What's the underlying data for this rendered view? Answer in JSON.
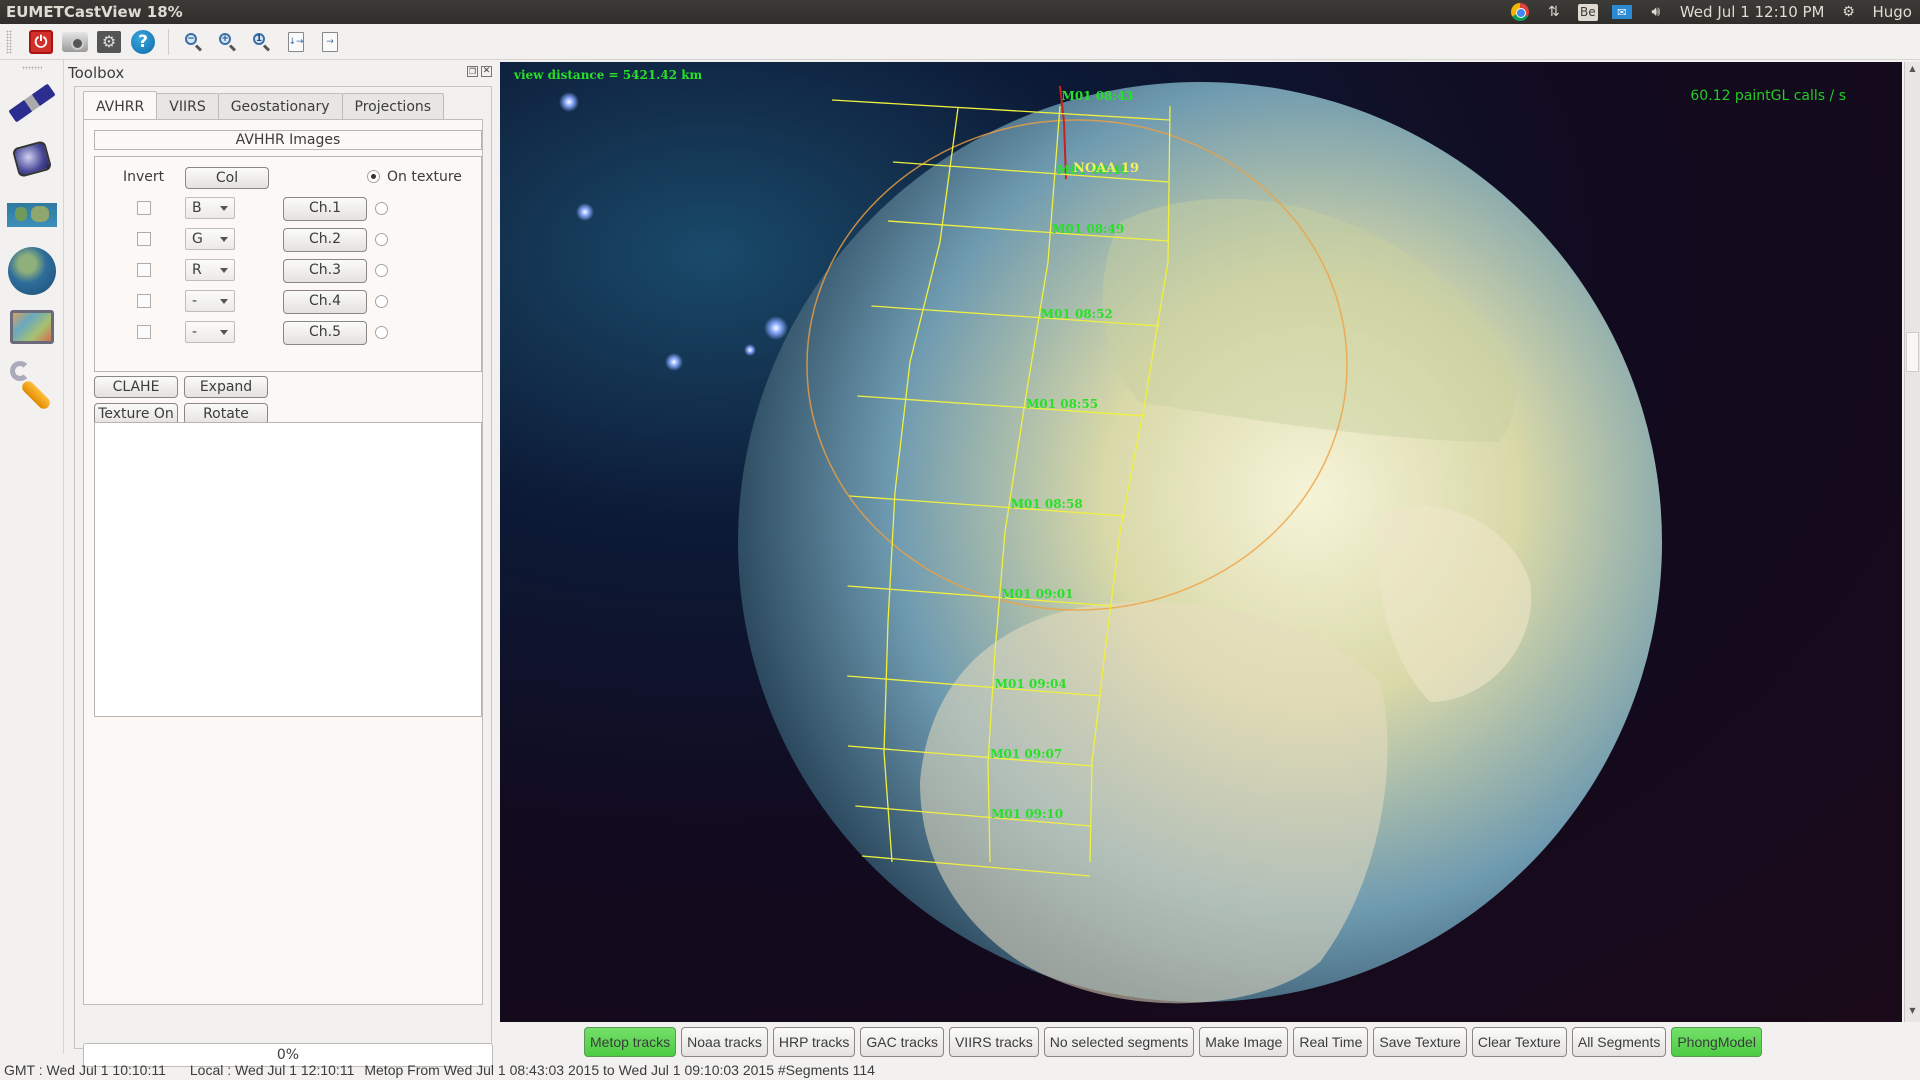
{
  "window": {
    "title": "EUMETCastView 18%"
  },
  "system_tray": {
    "icons": [
      "chrome-icon",
      "network-arrows-icon",
      "be-keyboard-icon",
      "mail-icon",
      "volume-icon"
    ],
    "keyboard_label": "Be",
    "clock": "Wed Jul  1 12:10 PM",
    "user": "Hugo"
  },
  "toolbar": {
    "buttons": [
      "power-icon",
      "camera-icon",
      "settings-icon",
      "help-icon",
      "zoom-out-icon",
      "zoom-in-icon",
      "zoom-reset-icon",
      "page-layout-icon",
      "page-flow-icon"
    ]
  },
  "sidebar": {
    "items": [
      {
        "name": "satellite-avhrr",
        "icon": "satellite-icon"
      },
      {
        "name": "satellite-geo",
        "icon": "satellite-body-icon"
      },
      {
        "name": "flat-map",
        "icon": "flat-map-icon"
      },
      {
        "name": "globe",
        "icon": "globe-icon"
      },
      {
        "name": "image-view",
        "icon": "image-icon"
      },
      {
        "name": "preferences",
        "icon": "wrench-icon"
      }
    ]
  },
  "toolbox": {
    "title": "Toolbox",
    "tabs": [
      {
        "label": "AVHRR",
        "active": true
      },
      {
        "label": "VIIRS",
        "active": false
      },
      {
        "label": "Geostationary",
        "active": false
      },
      {
        "label": "Projections",
        "active": false
      }
    ],
    "group_title": "AVHHR Images",
    "invert_label": "Invert",
    "col_button": "Col",
    "on_texture_label": "On texture",
    "on_texture_checked": true,
    "channels": [
      {
        "invert": false,
        "color": "B",
        "label": "Ch.1",
        "selected": false
      },
      {
        "invert": false,
        "color": "G",
        "label": "Ch.2",
        "selected": false
      },
      {
        "invert": false,
        "color": "R",
        "label": "Ch.3",
        "selected": false
      },
      {
        "invert": false,
        "color": "-",
        "label": "Ch.4",
        "selected": false
      },
      {
        "invert": false,
        "color": "-",
        "label": "Ch.5",
        "selected": false
      }
    ],
    "buttons": {
      "clahe": "CLAHE",
      "expand": "Expand",
      "texture_on": "Texture On",
      "rotate": "Rotate"
    },
    "log_text": "",
    "progress": "0%"
  },
  "view": {
    "distance_text": "view distance =  5421.42 km",
    "fps_text": "60.12 paintGL calls / s",
    "satellite_label": "NOAA 19",
    "segment_labels": [
      "M01 08:43",
      "M01 08:46",
      "M01 08:49",
      "M01 08:52",
      "M01 08:55",
      "M01 08:58",
      "M01 09:01",
      "M01 09:04",
      "M01 09:07",
      "M01 09:10"
    ],
    "colors": {
      "overlay_text": "#28e028",
      "segment_outline": "#f0f040",
      "coastline": "#c8c030",
      "footprint": "#f0a040",
      "track": "#cc2020"
    }
  },
  "bottom_buttons": [
    {
      "label": "Metop tracks",
      "on": true
    },
    {
      "label": "Noaa tracks",
      "on": false
    },
    {
      "label": "HRP tracks",
      "on": false
    },
    {
      "label": "GAC tracks",
      "on": false
    },
    {
      "label": "VIIRS tracks",
      "on": false
    },
    {
      "label": "No selected segments",
      "on": false
    },
    {
      "label": "Make Image",
      "on": false
    },
    {
      "label": "Real Time",
      "on": false
    },
    {
      "label": "Save Texture",
      "on": false
    },
    {
      "label": "Clear Texture",
      "on": false
    },
    {
      "label": "All Segments",
      "on": false
    },
    {
      "label": "PhongModel",
      "on": true
    }
  ],
  "status": {
    "gmt": "GMT : Wed Jul  1 10:10:11",
    "local": "Local : Wed Jul  1 12:10:11",
    "info": "Metop From Wed Jul 1 08:43:03 2015 to Wed Jul 1 09:10:03 2015  #Segments 114"
  }
}
